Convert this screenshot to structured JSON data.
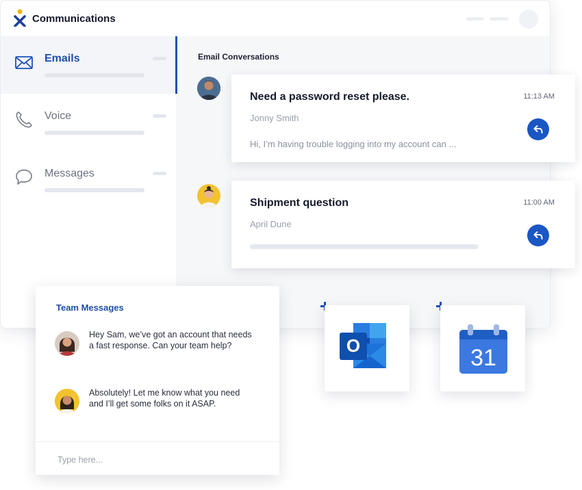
{
  "app": {
    "title": "Communications",
    "accent_color": "#1d4fb8",
    "logo_icon": "x-logo-icon"
  },
  "sidebar": {
    "items": [
      {
        "label": "Emails",
        "icon": "envelope-icon",
        "active": true
      },
      {
        "label": "Voice",
        "icon": "phone-icon",
        "active": false
      },
      {
        "label": "Messages",
        "icon": "chat-bubble-icon",
        "active": false
      }
    ]
  },
  "main": {
    "section_title": "Email Conversations",
    "conversations": [
      {
        "subject": "Need a password reset please.",
        "time": "11:13 AM",
        "sender": "Jonny Smith",
        "snippet": "Hi, I’m having trouble logging into my account can ...",
        "action_icon": "reply-icon"
      },
      {
        "subject": "Shipment question",
        "time": "11:00 AM",
        "sender": "April Dune",
        "snippet": "",
        "action_icon": "reply-icon"
      }
    ]
  },
  "team": {
    "title": "Team Messages",
    "messages": [
      {
        "text": "Hey Sam, we’ve got an account that needs a fast response. Can your team help?"
      },
      {
        "text": "Absolutely! Let me know what you need and I’ll get some folks on it ASAP."
      }
    ],
    "input_placeholder": "Type here..."
  },
  "integrations": {
    "outlook": {
      "icon": "outlook-icon",
      "letter": "O",
      "color": "#0f64c8"
    },
    "calendar": {
      "icon": "google-calendar-icon",
      "day": "31",
      "color": "#3b78e0"
    }
  }
}
